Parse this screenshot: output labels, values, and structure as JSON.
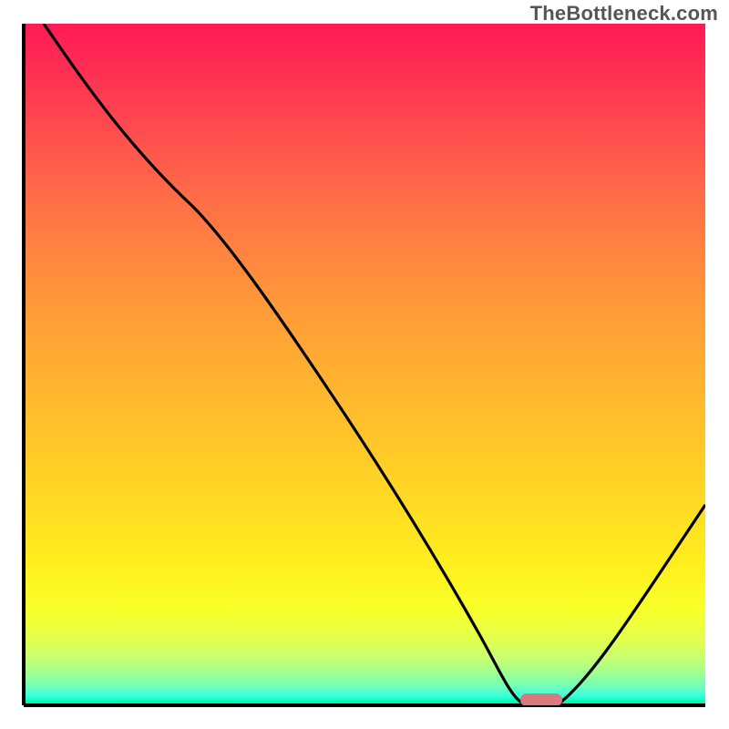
{
  "watermark": "TheBottleneck.com",
  "chart_data": {
    "type": "line",
    "title": "",
    "xlabel": "",
    "ylabel": "",
    "xlim": [
      0,
      100
    ],
    "ylim": [
      0,
      100
    ],
    "x": [
      3,
      10,
      18,
      25,
      35,
      45,
      55,
      64,
      68,
      72,
      75,
      80,
      90,
      100
    ],
    "values": [
      100,
      92,
      82,
      73,
      58,
      44,
      30,
      15,
      6,
      1,
      0,
      0,
      12,
      28
    ],
    "gradient_stops": [
      {
        "pos": 100,
        "color": "#ff1a55"
      },
      {
        "pos": 80,
        "color": "#ff9b38"
      },
      {
        "pos": 50,
        "color": "#ffc828"
      },
      {
        "pos": 20,
        "color": "#fff01e"
      },
      {
        "pos": 5,
        "color": "#9cff96"
      },
      {
        "pos": 0,
        "color": "#00e88c"
      }
    ],
    "marker": {
      "x": 76,
      "y": 0,
      "color": "#d97b7e"
    }
  }
}
